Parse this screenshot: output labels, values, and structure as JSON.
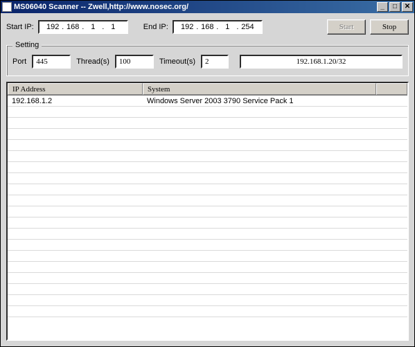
{
  "window": {
    "title": "MS06040 Scanner -- Zwell,http://www.nosec.org/"
  },
  "toolbar": {
    "start_ip_label": "Start IP:",
    "end_ip_label": "End IP:",
    "start_ip": {
      "o1": "192",
      "o2": "168",
      "o3": "1",
      "o4": "1"
    },
    "end_ip": {
      "o1": "192",
      "o2": "168",
      "o3": "1",
      "o4": "254"
    },
    "start_btn": "Start",
    "stop_btn": "Stop"
  },
  "setting": {
    "legend": "Setting",
    "port_label": "Port",
    "port_value": "445",
    "thread_label": "Thread(s)",
    "thread_value": "100",
    "timeout_label": "Timeout(s)",
    "timeout_value": "2",
    "status_text": "192.168.1.20/32"
  },
  "list": {
    "col_ip": "IP Address",
    "col_sys": "System",
    "rows": [
      {
        "ip": "192.168.1.2",
        "system": "Windows Server 2003 3790 Service Pack 1"
      }
    ]
  }
}
